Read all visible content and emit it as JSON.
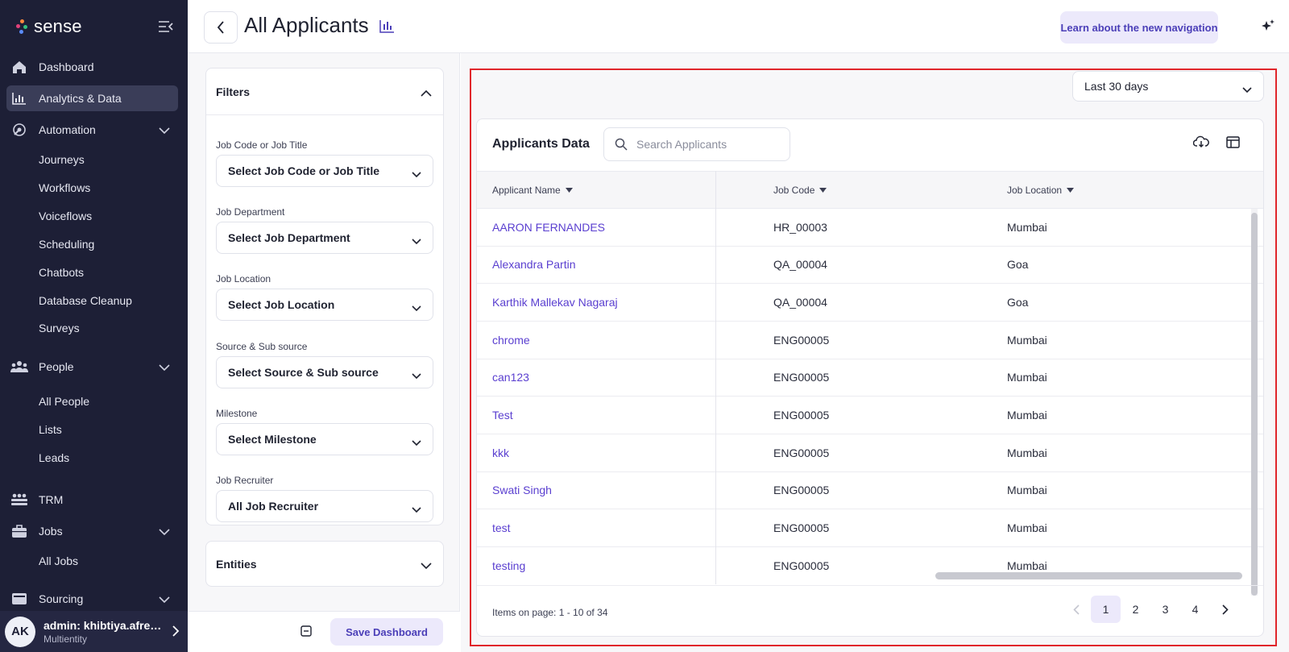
{
  "app": {
    "brand": "sense"
  },
  "sidebar": {
    "items": [
      {
        "label": "Dashboard",
        "icon": "home-icon"
      },
      {
        "label": "Analytics & Data",
        "icon": "bar-chart-icon",
        "active": true
      },
      {
        "label": "Automation",
        "icon": "automation-icon",
        "expanded": true
      },
      {
        "label": "People",
        "icon": "people-icon",
        "expanded": true
      },
      {
        "label": "TRM",
        "icon": "trm-icon"
      },
      {
        "label": "Jobs",
        "icon": "briefcase-icon",
        "expanded": true
      },
      {
        "label": "Sourcing",
        "icon": "sourcing-icon",
        "expanded": true
      }
    ],
    "automation_sub": [
      "Journeys",
      "Workflows",
      "Voiceflows",
      "Scheduling",
      "Chatbots",
      "Database Cleanup",
      "Surveys"
    ],
    "people_sub": [
      "All People",
      "Lists",
      "Leads"
    ],
    "jobs_sub": [
      "All Jobs"
    ],
    "user": {
      "initials": "AK",
      "name": "admin: khibtiya.afreen@...",
      "subtitle": "Multientity"
    }
  },
  "header": {
    "title": "All Applicants",
    "learn_button": "Learn about the new navigation"
  },
  "filters": {
    "title": "Filters",
    "fields": [
      {
        "label": "Job Code or Job Title",
        "value": "Select Job Code or Job Title"
      },
      {
        "label": "Job Department",
        "value": "Select Job Department"
      },
      {
        "label": "Job Location",
        "value": "Select Job Location"
      },
      {
        "label": "Source & Sub source",
        "value": "Select Source & Sub source"
      },
      {
        "label": "Milestone",
        "value": "Select Milestone"
      },
      {
        "label": "Job Recruiter",
        "value": "All Job Recruiter"
      }
    ],
    "entities_title": "Entities",
    "save_button": "Save Dashboard"
  },
  "main": {
    "date_range": "Last 30 days",
    "card_title": "Applicants Data",
    "search_placeholder": "Search Applicants",
    "columns": [
      "Applicant Name",
      "Job Code",
      "Job Location"
    ],
    "rows": [
      {
        "name": "AARON FERNANDES",
        "code": "HR_00003",
        "location": "Mumbai"
      },
      {
        "name": "Alexandra Partin",
        "code": "QA_00004",
        "location": "Goa"
      },
      {
        "name": "Karthik Mallekav Nagaraj",
        "code": "QA_00004",
        "location": "Goa"
      },
      {
        "name": "chrome",
        "code": "ENG00005",
        "location": "Mumbai"
      },
      {
        "name": "can123",
        "code": "ENG00005",
        "location": "Mumbai"
      },
      {
        "name": "Test",
        "code": "ENG00005",
        "location": "Mumbai"
      },
      {
        "name": "kkk",
        "code": "ENG00005",
        "location": "Mumbai"
      },
      {
        "name": "Swati Singh",
        "code": "ENG00005",
        "location": "Mumbai"
      },
      {
        "name": "test",
        "code": "ENG00005",
        "location": "Mumbai"
      },
      {
        "name": "testing",
        "code": "ENG00005",
        "location": "Mumbai"
      }
    ],
    "items_text": "Items on page: 1 - 10 of 34",
    "pages": [
      "1",
      "2",
      "3",
      "4"
    ],
    "current_page": "1"
  },
  "colors": {
    "sidebar_bg": "#1d1f36",
    "accent": "#5a3fd0",
    "accent_soft": "#ece9fb",
    "highlight": "#e0262b"
  }
}
